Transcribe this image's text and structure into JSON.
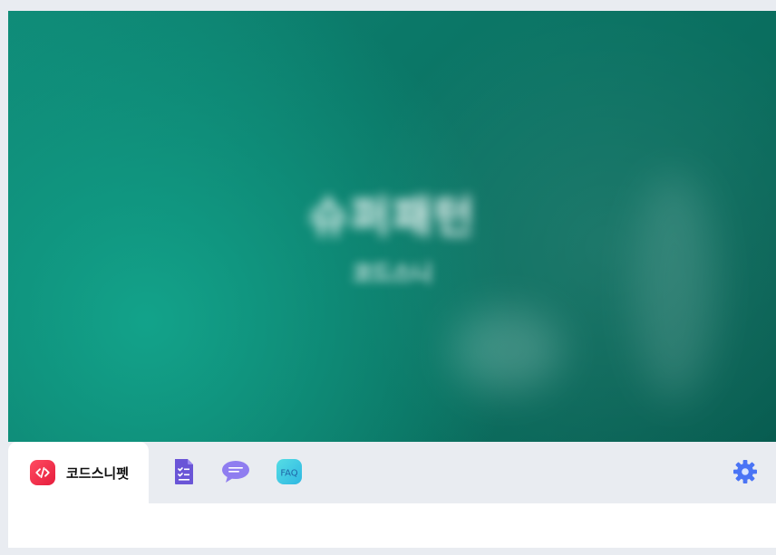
{
  "hero": {
    "title": "슈퍼패턴",
    "subtitle": "코드스니"
  },
  "tabs": {
    "active": {
      "label": "코드스니펫",
      "icon": "code-icon"
    },
    "icons": [
      {
        "name": "document-checklist-icon"
      },
      {
        "name": "chat-bubble-icon"
      },
      {
        "name": "faq-icon",
        "label": "FAQ"
      },
      {
        "name": "gear-icon"
      }
    ]
  },
  "colors": {
    "hero_start": "#0f8a77",
    "hero_end": "#075c50",
    "accent_red": "#e61d3d",
    "doc_purple": "#6a55d7",
    "chat_purple": "#8f7df0",
    "faq_cyan": "#39c7e6",
    "gear_blue": "#4a74f5"
  }
}
